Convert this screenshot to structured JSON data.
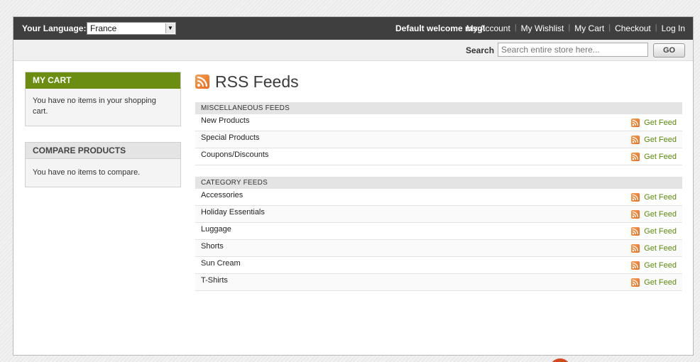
{
  "header": {
    "language_label": "Your Language:",
    "language_value": "France",
    "welcome": "Default welcome msg!",
    "links": [
      "My Account",
      "My Wishlist",
      "My Cart",
      "Checkout",
      "Log In"
    ]
  },
  "search": {
    "label": "Search",
    "placeholder": "Search entire store here...",
    "button": "GO"
  },
  "sidebar": {
    "cart_title": "MY CART",
    "cart_text": "You have no items in your shopping cart.",
    "compare_title": "COMPARE PRODUCTS",
    "compare_text": "You have no items to compare."
  },
  "main": {
    "title": "RSS Feeds",
    "misc_head": "MISCELLANEOUS FEEDS",
    "misc_feeds": [
      "New Products",
      "Special Products",
      "Coupons/Discounts"
    ],
    "cat_head": "CATEGORY FEEDS",
    "cat_feeds": [
      "Accessories",
      "Holiday Essentials",
      "Luggage",
      "Shorts",
      "Sun Cream",
      "T-Shirts"
    ],
    "get_feed_label": "Get Feed"
  },
  "colors": {
    "topbar": "#3f3f3f",
    "cart_header": "#6b8d12",
    "link_green": "#5d8a0c",
    "rss_orange": "#e8691c"
  },
  "icons": [
    "rss-icon",
    "chevron-down-icon"
  ]
}
